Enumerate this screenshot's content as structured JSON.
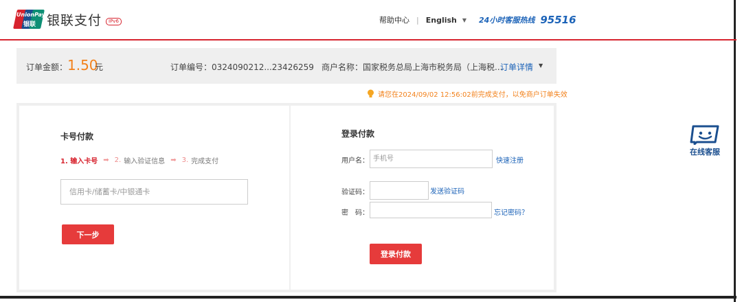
{
  "header": {
    "logo_text_top": "UnionPay",
    "logo_text_bottom": "银联",
    "title": "银联支付",
    "badge": "IPv6",
    "help_link": "帮助中心",
    "separator": "|",
    "language": "English",
    "hotline_label": "24小时客服热线",
    "hotline_number": "95516"
  },
  "order": {
    "amount_label": "订单金额：",
    "amount_value": "1.50",
    "amount_unit": "元",
    "order_number": "订单编号：0324090212...23426259",
    "merchant": "商户名称：国家税务总局上海市税务局（上海税...",
    "detail_link": "订单详情"
  },
  "notice": "请您在2024/09/02 12:56:02前完成支付，以免商户订单失效",
  "card_pay": {
    "title": "卡号付款",
    "steps": [
      {
        "num": "1.",
        "label": "输入卡号"
      },
      {
        "num": "2.",
        "label": "输入验证信息"
      },
      {
        "num": "3.",
        "label": "完成支付"
      }
    ],
    "card_placeholder": "信用卡/储蓄卡/中银通卡",
    "next_button": "下一步"
  },
  "login_pay": {
    "title": "登录付款",
    "username_label": "用户名：",
    "username_placeholder": "手机号",
    "register_link": "快速注册",
    "code_label": "验证码：",
    "send_code_link": "发送验证码",
    "password_label": "密　码：",
    "forgot_link": "忘记密码？",
    "login_button": "登录付款"
  },
  "service": {
    "label": "在线客服"
  },
  "colors": {
    "brand_red": "#d7232e",
    "button_red": "#e63b3b",
    "amount_orange": "#f2811b",
    "link_blue": "#1c63b8"
  }
}
